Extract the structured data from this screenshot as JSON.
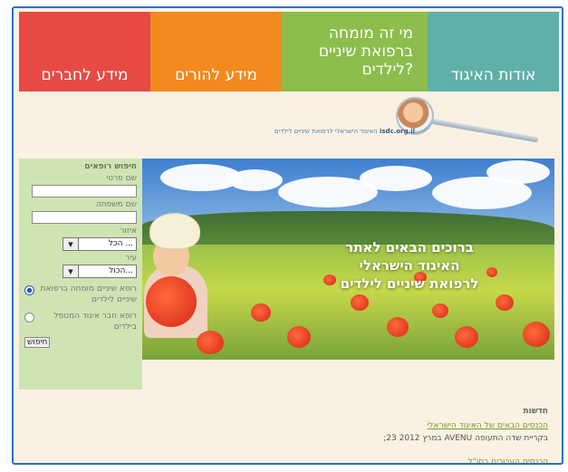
{
  "nav": {
    "items": [
      {
        "label": "מידע לחברים",
        "color": "#e74a44"
      },
      {
        "label": "מידע להורים",
        "color": "#f28a1f"
      },
      {
        "label": "מי זה מומחה\nברפואת שיניים\nלילדים?",
        "color": "#8dbd4c"
      },
      {
        "label": "אודות האיגוד",
        "color": "#5fb0a8"
      }
    ]
  },
  "logo": {
    "domain": "isdc.org.il",
    "tagline": "האיגוד הישראלי לרפואת שיניים לילדים"
  },
  "search": {
    "title": "חיפוש רופאים",
    "first_name_label": "שם פרטי",
    "last_name_label": "שם משפחה",
    "region_label": "איזור",
    "region_value": "הכל ...",
    "city_label": "עיר",
    "city_value": "הכול...",
    "radio_specialist": "רופא שיניים מומחה ברפואת שיניים לילדים",
    "radio_member": "רופא חבר איגוד המטפל בילדים",
    "button": "חיפוש"
  },
  "hero": {
    "welcome": "ברוכים הבאים לאתר\nהאיגוד הישראלי\nלרפואת שיניים לילדים"
  },
  "news": {
    "heading": "חדשות",
    "item1_title": "הכנסים הבאים של האיגוד הישראלי",
    "item1_desc": "בקריית שדה התעופה AVENU במרץ 2012 23;",
    "item2_title": "הכנסים הערוכים בחו\"ל"
  },
  "colors": {
    "frame_border": "#2f6fbf",
    "page_bg": "#faf1e2",
    "search_bg": "#cfe4b3",
    "link": "#7a9a2a"
  }
}
